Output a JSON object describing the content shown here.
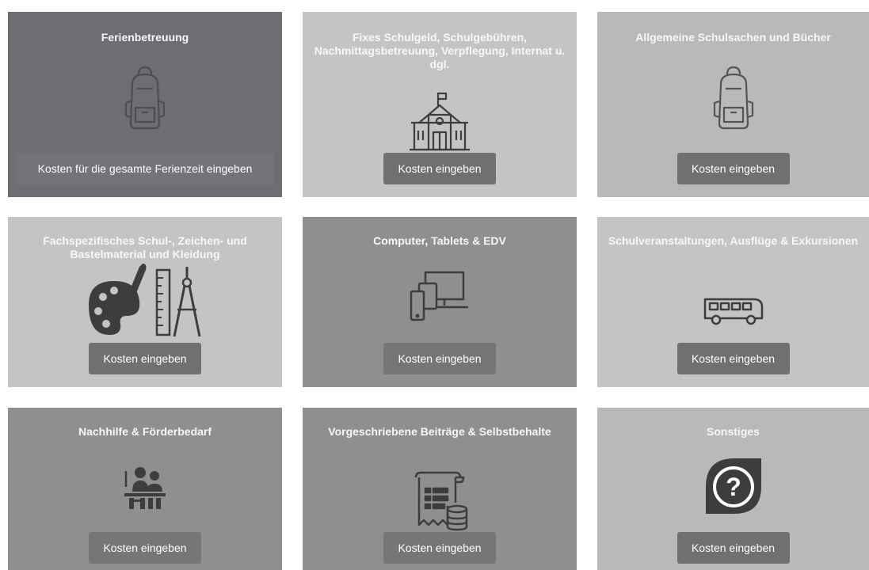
{
  "cards": [
    {
      "title": "Ferienbetreuung",
      "icon": "backpack-icon",
      "button": "Kosten für die gesamte Ferienzeit eingeben"
    },
    {
      "title": "Fixes Schulgeld, Schulgebühren, Nachmittagsbetreuung, Verpflegung, Internat u. dgl.",
      "icon": "school-building-icon",
      "button": "Kosten eingeben"
    },
    {
      "title": "Allgemeine Schulsachen und Bücher",
      "icon": "backpack-icon",
      "button": "Kosten eingeben"
    },
    {
      "title": "Fachspezifisches Schul-, Zeichen- und Bastelmaterial und Kleidung",
      "icon": "palette-ruler-compass-icon",
      "button": "Kosten eingeben"
    },
    {
      "title": "Computer, Tablets & EDV",
      "icon": "devices-icon",
      "button": "Kosten eingeben"
    },
    {
      "title": "Schulveranstaltungen, Ausflüge & Exkursionen",
      "icon": "bus-icon",
      "button": "Kosten eingeben"
    },
    {
      "title": "Nachhilfe & Förderbedarf",
      "icon": "tutoring-icon",
      "button": "Kosten eingeben"
    },
    {
      "title": "Vorgeschriebene Beiträge & Selbstbehalte",
      "icon": "invoice-coins-icon",
      "button": "Kosten eingeben"
    },
    {
      "title": "Sonstiges",
      "icon": "question-mark-icon",
      "button": "Kosten eingeben"
    }
  ],
  "colors": {
    "card_dark": "#6e6e72",
    "card_mid": "#8f8f92",
    "card_light": "#b9b9bb",
    "card_lighter": "#c4c4c6",
    "button_dark": "#707073",
    "icon_dark": "#3d3d3f"
  }
}
